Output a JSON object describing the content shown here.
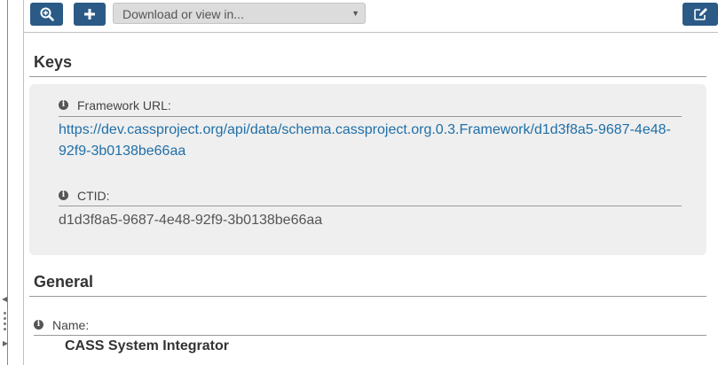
{
  "toolbar": {
    "zoom_button_icon": "zoom-in-icon",
    "add_button_icon": "plus-icon",
    "download_select": {
      "placeholder": "Download or view in..."
    },
    "edit_button_icon": "edit-icon",
    "button_color": "#2b5a86"
  },
  "keys": {
    "title": "Keys",
    "framework_url": {
      "label": "Framework URL:",
      "line1": "https://dev.cassproject.org/api/data/schema.cassproject.org.0.3.Framework/d1d3f8a5-9687-4e48-",
      "line2": "92f9-3b0138be66aa"
    },
    "ctid": {
      "label": "CTID:",
      "value": "d1d3f8a5-9687-4e48-92f9-3b0138be66aa"
    }
  },
  "general": {
    "title": "General",
    "name": {
      "label": "Name:",
      "value": "CASS System Integrator"
    }
  },
  "colors": {
    "link": "#1f6fa8",
    "keys_background": "#efefef"
  }
}
